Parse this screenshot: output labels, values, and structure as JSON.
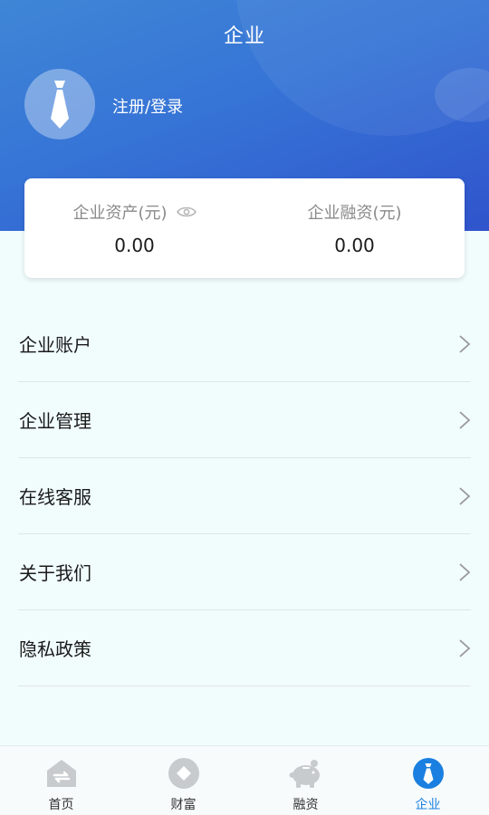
{
  "header": {
    "title": "企业"
  },
  "profile": {
    "login_label": "注册/登录"
  },
  "assets": {
    "enterprise_assets_label": "企业资产(元)",
    "enterprise_assets_value": "0.00",
    "enterprise_financing_label": "企业融资(元)",
    "enterprise_financing_value": "0.00"
  },
  "menu": {
    "items": [
      {
        "label": "企业账户"
      },
      {
        "label": "企业管理"
      },
      {
        "label": "在线客服"
      },
      {
        "label": "关于我们"
      },
      {
        "label": "隐私政策"
      }
    ]
  },
  "tabbar": {
    "active_color": "#1a7fe0",
    "inactive_icon_color": "#c7cbcd",
    "items": [
      {
        "label": "首页",
        "icon": "home-icon"
      },
      {
        "label": "财富",
        "icon": "wealth-icon"
      },
      {
        "label": "融资",
        "icon": "piggy-bank-icon"
      },
      {
        "label": "企业",
        "icon": "tie-icon"
      }
    ]
  }
}
